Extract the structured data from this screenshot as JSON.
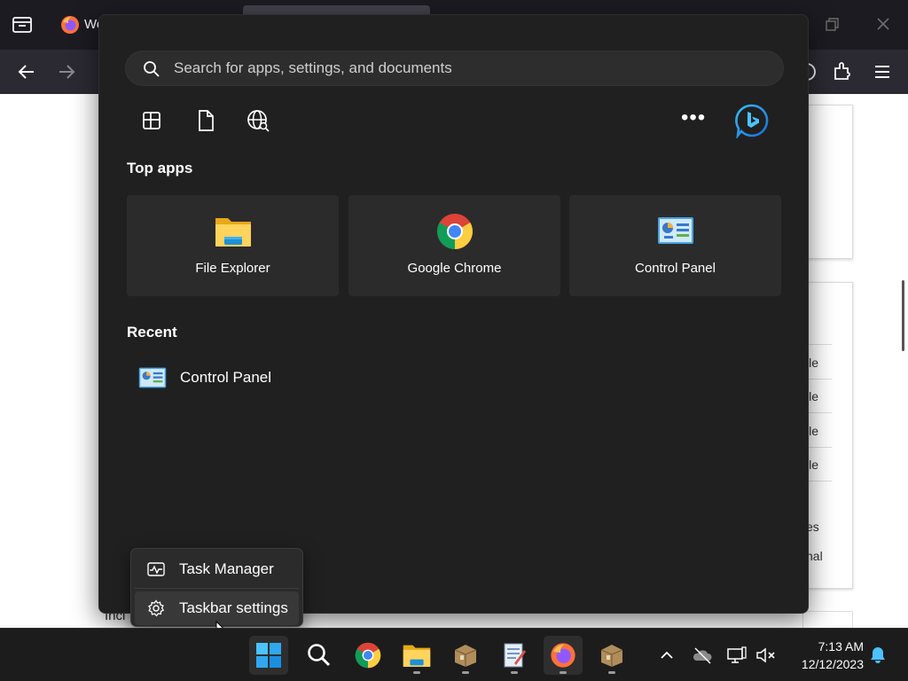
{
  "browser": {
    "tab_title": "We",
    "page_right_texts": [
      "ile",
      "ile",
      "ile",
      "ile",
      "es",
      "nal"
    ],
    "behind_text": "Incl"
  },
  "start_menu": {
    "search": {
      "placeholder": "Search for apps, settings, and documents",
      "value": ""
    },
    "filters": [
      "apps-icon",
      "documents-icon",
      "web-icon"
    ],
    "more_label": "•••",
    "top_apps_title": "Top apps",
    "top_apps": [
      {
        "label": "File Explorer",
        "icon": "file-explorer-icon"
      },
      {
        "label": "Google Chrome",
        "icon": "chrome-icon"
      },
      {
        "label": "Control Panel",
        "icon": "control-panel-icon"
      }
    ],
    "recent_title": "Recent",
    "recent": [
      {
        "label": "Control Panel",
        "icon": "control-panel-icon"
      }
    ]
  },
  "context_menu": {
    "items": [
      {
        "label": "Task Manager",
        "icon": "task-manager-icon"
      },
      {
        "label": "Taskbar settings",
        "icon": "gear-icon"
      }
    ]
  },
  "taskbar": {
    "time": "7:13 AM",
    "date": "12/12/2023",
    "colors": {
      "accent": "#4cc2ff",
      "taskbar_bg": "#1c1c1c",
      "menu_bg": "#202020"
    }
  }
}
